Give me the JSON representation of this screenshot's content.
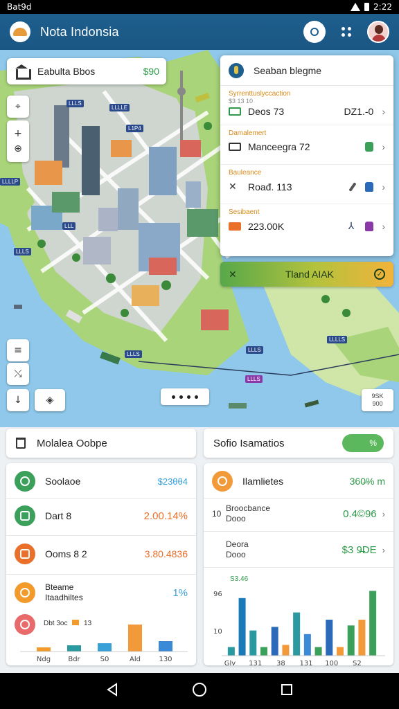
{
  "status": {
    "carrier": "Bat9d",
    "time": "2:22"
  },
  "app": {
    "title": "Nota Indonsia"
  },
  "map": {
    "search_label": "Eabulta Bbos",
    "search_price": "$90",
    "zoom_label_top": "9SK",
    "zoom_label_bottom": "900"
  },
  "panel": {
    "header": "Seaban blegme",
    "rows": [
      {
        "category": "Syrrenttuslyccaction",
        "sub": "$3 13 10",
        "name": "Deos 73",
        "value": "DZ1.-0",
        "icon_color": "#2e9a4a"
      },
      {
        "category": "Damalemert",
        "sub": "",
        "name": "Manceegra 72",
        "value": "",
        "icon_color": "#2e7a2a"
      },
      {
        "category": "Bauleance",
        "sub": "",
        "name": "Roađ. 113",
        "value": "",
        "icon_color": "#333333"
      },
      {
        "category": "Sesibaent",
        "sub": "",
        "name": "223.00K",
        "value": "",
        "icon_color": "#e8702a"
      }
    ],
    "cta_label": "Tland AIAK"
  },
  "lower": {
    "left_bar_title": "Molalea Oobpe",
    "right_bar_title": "Sofio Isamatios",
    "toggle_label": "%",
    "left_rows": [
      {
        "name": "Soolaoe",
        "value": "$23θθ4",
        "color": "#3aa0d8",
        "circle": "#3aa05a"
      },
      {
        "name": "Dart 8",
        "value": "2.00.14%",
        "color": "#e8702a",
        "circle": "#3aa05a"
      },
      {
        "name": "Ooms 8 2",
        "value": "3.80.4836",
        "color": "#e8702a",
        "circle": "#e8702a"
      }
    ],
    "left_row4": {
      "line1": "Bteame",
      "line2": "Itaadhiltes",
      "value": "1%",
      "color": "#3aa0d8",
      "circle": "#f29a2a"
    },
    "left_chart_legend": "Dbt 3oc",
    "left_chart_legend2": "13",
    "right_head": {
      "name": "Ilamlietes",
      "value": "360̶% m",
      "circle": "#f29a3a"
    },
    "right_rows": [
      {
        "prefix": "10",
        "line1": "Broocbance",
        "line2": "Dooo",
        "value": "0.4©96"
      },
      {
        "prefix": "",
        "line1": "Deora",
        "line2": "Dooo",
        "value": "$3 9̶DE"
      }
    ],
    "right_chart_label": "S3.46"
  },
  "chart_data": [
    {
      "type": "bar",
      "categories": [
        "Ndg",
        "Bdr",
        "S0",
        "Ald",
        "130"
      ],
      "series": [
        {
          "values": [
            10,
            15,
            20,
            65,
            25
          ]
        }
      ],
      "ylim": [
        0,
        80
      ]
    },
    {
      "type": "bar",
      "categories": [
        "Gly",
        "131",
        "38",
        "131",
        "100",
        "S2"
      ],
      "y_tick_labels": [
        "96",
        "10"
      ],
      "series": [
        {
          "values": [
            12,
            80,
            35,
            12,
            40,
            15,
            60,
            30,
            12,
            50,
            12,
            42,
            50,
            90
          ]
        }
      ],
      "ylim": [
        0,
        100
      ]
    }
  ]
}
